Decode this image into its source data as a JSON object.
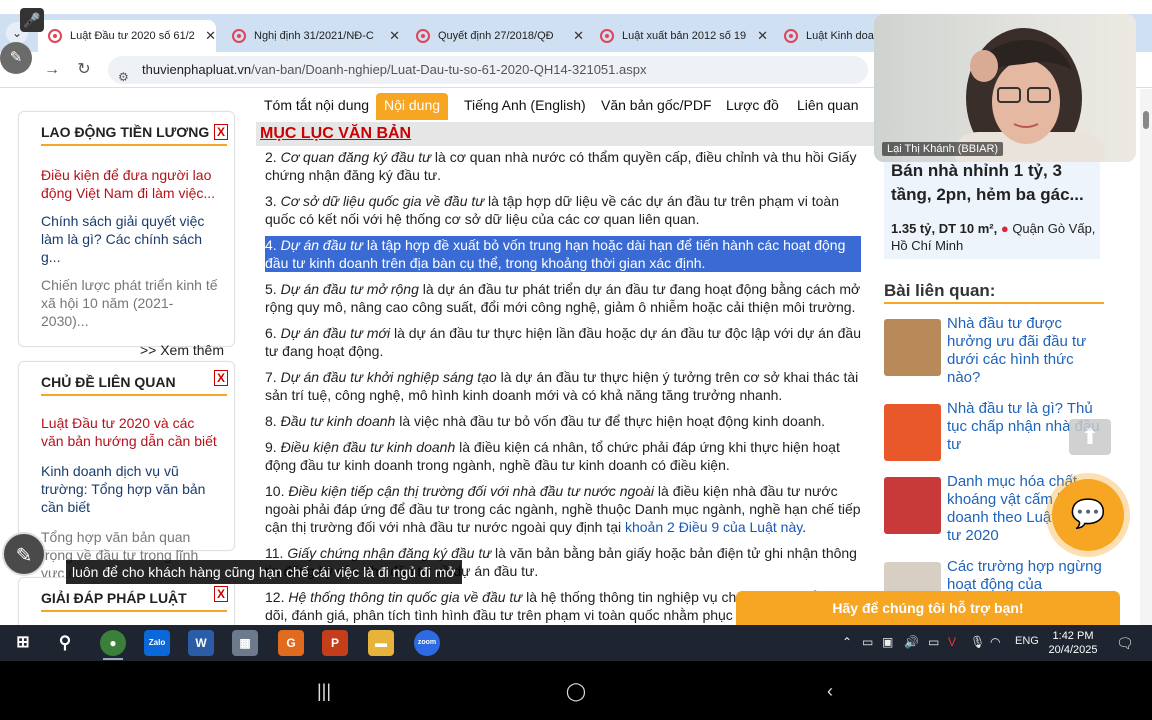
{
  "browser": {
    "tabs": [
      {
        "label": "Luật Đầu tư 2020 số 61/2",
        "active": true
      },
      {
        "label": "Nghị định 31/2021/NĐ-C",
        "active": false
      },
      {
        "label": "Quyết định 27/2018/QĐ",
        "active": false
      },
      {
        "label": "Luật xuất bản 2012 số 19",
        "active": false
      },
      {
        "label": "Luật Kinh doanh",
        "active": false
      }
    ],
    "url_host": "thuvienphapluat.vn",
    "url_path": "/van-ban/Doanh-nghiep/Luat-Dau-tu-so-61-2020-QH14-321051.aspx"
  },
  "sidebar": {
    "boxes": [
      {
        "title": "LAO ĐỘNG TIỀN LƯƠNG",
        "close": "X",
        "items": [
          {
            "text": "Điều kiện để đưa người lao động Việt Nam đi làm việc...",
            "style": "red"
          },
          {
            "text": "Chính sách giải quyết việc làm là gì? Các chính sách g...",
            "style": "dark"
          },
          {
            "text": "Chiến lược phát triển kinh tế xã hội 10 năm (2021-2030)...",
            "style": "gray"
          }
        ],
        "more": ">> Xem thêm"
      },
      {
        "title": "CHỦ ĐỀ LIÊN QUAN",
        "close": "X",
        "items": [
          {
            "text": "Luật Đầu tư 2020 và các văn bản hướng dẫn cần biết",
            "style": "red"
          },
          {
            "text": "Kinh doanh dịch vụ vũ trường: Tổng hợp văn bản cần biết",
            "style": "dark"
          },
          {
            "text": "Tổng hợp văn bản quan trọng về đầu tư trong lĩnh vực giá...",
            "style": "gray"
          }
        ]
      },
      {
        "title": "GIẢI ĐÁP PHÁP LUẬT",
        "close": "X",
        "items": []
      }
    ]
  },
  "content_tabs": [
    {
      "label": "Tóm tắt nội dung",
      "active": false
    },
    {
      "label": "Nội dung",
      "active": true
    },
    {
      "label": "Tiếng Anh (English)",
      "active": false
    },
    {
      "label": "Văn bản gốc/PDF",
      "active": false
    },
    {
      "label": "Lược đồ",
      "active": false
    },
    {
      "label": "Liên quan hiệ",
      "active": false
    }
  ],
  "toc_label": "MỤC LỤC VĂN BẢN",
  "law_paragraphs": [
    {
      "num": "2. ",
      "term": "Cơ quan đăng ký đầu tư",
      "rest": " là cơ quan nhà nước có thẩm quyền cấp, điều chỉnh và thu hồi Giấy chứng nhận đăng ký đầu tư.",
      "highlight": false
    },
    {
      "num": "3. ",
      "term": "Cơ sở dữ liệu quốc gia về đầu tư",
      "rest": " là tập hợp dữ liệu về các dự án đầu tư trên phạm vi toàn quốc có kết nối với hệ thống cơ sở dữ liệu của các cơ quan liên quan.",
      "highlight": false
    },
    {
      "num": "4. ",
      "term": "Dự án đầu tư",
      "rest": " là tập hợp đề xuất bỏ vốn trung hạn hoặc dài hạn để tiến hành các hoạt động đầu tư kinh doanh trên địa bàn cụ thể, trong khoảng thời gian xác định.",
      "highlight": true
    },
    {
      "num": "5. ",
      "term": "Dự án đầu tư mở rộng",
      "rest": " là dự án đầu tư phát triển dự án đầu tư đang hoạt động bằng cách mở rộng quy mô, nâng cao công suất, đổi mới công nghệ, giảm ô nhiễm hoặc cải thiện môi trường.",
      "highlight": false
    },
    {
      "num": "6. ",
      "term": "Dự án đầu tư mới",
      "rest": " là dự án đầu tư thực hiện lần đầu hoặc dự án đầu tư độc lập với dự án đầu tư đang hoạt động.",
      "highlight": false
    },
    {
      "num": "7. ",
      "term": "Dự án đầu tư khởi nghiệp sáng tạo",
      "rest": " là dự án đầu tư thực hiện ý tưởng trên cơ sở khai thác tài sản trí tuệ, công nghệ, mô hình kinh doanh mới và có khả năng tăng trưởng nhanh.",
      "highlight": false
    },
    {
      "num": "8. ",
      "term": "Đầu tư kinh doanh",
      "rest": " là việc nhà đầu tư bỏ vốn đầu tư để thực hiện hoạt động kinh doanh.",
      "highlight": false
    },
    {
      "num": "9. ",
      "term": "Điều kiện đầu tư kinh doanh",
      "rest": " là điều kiện cá nhân, tổ chức phải đáp ứng khi thực hiện hoạt động đầu tư kinh doanh trong ngành, nghề đầu tư kinh doanh có điều kiện.",
      "highlight": false
    },
    {
      "num": "10. ",
      "term": "Điều kiện tiếp cận thị trường đối với nhà đầu tư nước ngoài",
      "rest": " là điều kiện nhà đầu tư nước ngoài phải đáp ứng để đầu tư trong các ngành, nghề thuộc Danh mục ngành, nghề hạn chế tiếp cận thị trường đối với nhà đầu tư nước ngoài quy định tại ",
      "link": "khoản 2 Điều 9 của Luật này",
      "tail": ".",
      "highlight": false
    },
    {
      "num": "11. ",
      "term": "Giấy chứng nhận đăng ký đầu tư",
      "rest": " là văn bản bằng bản giấy hoặc bản điện tử ghi nhận thông tin đăng ký của nhà đầu tư về dự án đầu tư.",
      "highlight": false
    },
    {
      "num": "12. ",
      "term": "Hệ thống thông tin quốc gia về đầu tư",
      "rest": " là hệ thống thông tin nghiệp vụ chuyên môn để theo dõi, đánh giá, phân tích tình hình đầu tư trên phạm vi toàn quốc nhằm phục vụ công tác quản lý nhà nước.",
      "highlight": false
    }
  ],
  "ad": {
    "title": "Bán nhà nhỉnh 1 tỷ, 3 tầng, 2pn, hẻm ba gác...",
    "price_area": "1.35 tỷ, DT 10 m²,",
    "location": "Quận Gò Vấp, Hồ Chí Minh"
  },
  "related": {
    "heading": "Bài liên quan:",
    "items": [
      {
        "title": "Nhà đầu tư được hưởng ưu đãi đầu tư dưới các hình thức nào?",
        "thumb_color": "#b88a5a"
      },
      {
        "title": "Nhà đầu tư là gì? Thủ tục chấp nhận nhà đầu tư",
        "thumb_color": "#e8582a"
      },
      {
        "title": "Danh mục hóa chất, khoáng vật cấm kinh doanh theo Luật Đầu tư 2020",
        "thumb_color": "#c83a3a"
      },
      {
        "title": "Các trường hợp ngừng hoạt động của",
        "thumb_color": "#d7cfc4"
      }
    ]
  },
  "support_text": "Hãy để chúng tôi hỗ trợ bạn!",
  "subtitle": "luôn để cho khách hàng cũng hạn chế cái việc là đi ngủ đi mở",
  "webcam_name": "Lại Thị Khánh (BBIAR)",
  "taskbar": {
    "apps": [
      "Chrome",
      "Zalo",
      "Word",
      "Snip",
      "Slides",
      "PowerPoint",
      "Files",
      "Zoom"
    ],
    "lang": "ENG",
    "time": "1:42 PM",
    "date": "20/4/2025"
  },
  "colors": {
    "accent_orange": "#f6a623",
    "link_blue": "#1f63b9",
    "heading_red": "#c00000",
    "highlight_blue": "#3a6bd4"
  }
}
